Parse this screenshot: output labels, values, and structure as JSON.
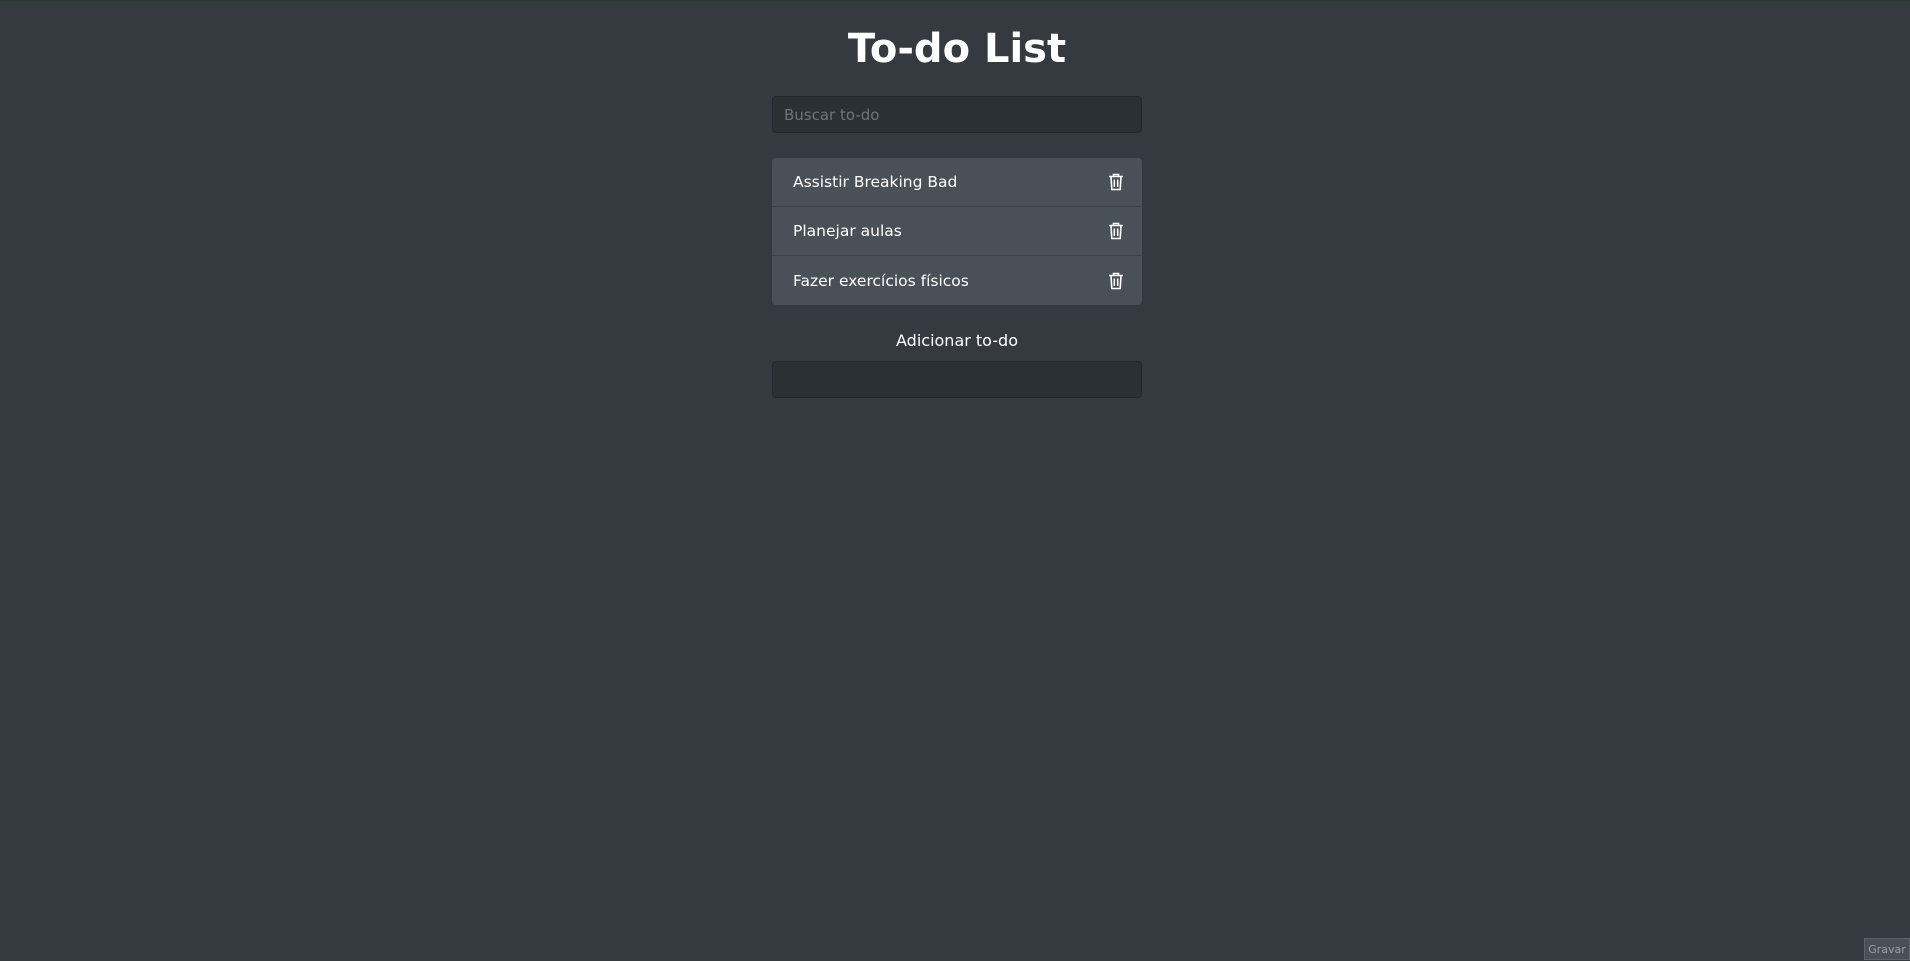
{
  "page": {
    "title": "To-do List"
  },
  "search": {
    "placeholder": "Buscar to-do",
    "value": ""
  },
  "todos": [
    {
      "text": "Assistir Breaking Bad",
      "delete_icon": "trash-icon"
    },
    {
      "text": "Planejar aulas",
      "delete_icon": "trash-icon"
    },
    {
      "text": "Fazer exercícios físicos",
      "delete_icon": "trash-icon"
    }
  ],
  "add_form": {
    "label": "Adicionar to-do",
    "value": ""
  },
  "corner_button": {
    "label": "Gravar"
  },
  "colors": {
    "background": "#343a40",
    "input_background": "#2b3035",
    "list_item_background": "#495057",
    "text": "#ffffff"
  }
}
